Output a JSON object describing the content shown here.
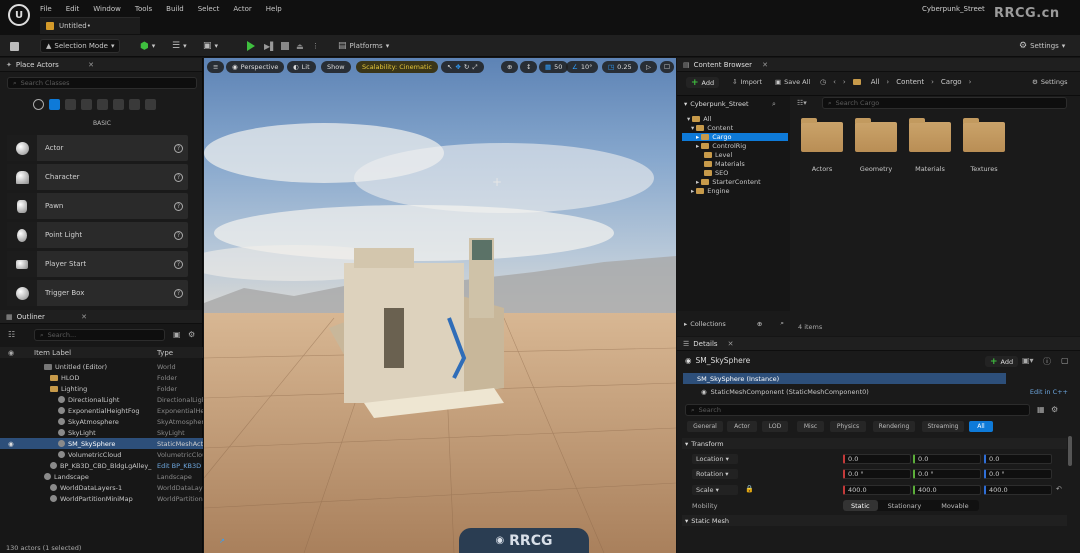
{
  "menu": [
    "File",
    "Edit",
    "Window",
    "Tools",
    "Build",
    "Select",
    "Actor",
    "Help"
  ],
  "tab_title": "Untitled•",
  "project_name": "Cyberpunk_Street",
  "watermark": "RRCG.cn",
  "toolbar": {
    "selection_mode": "Selection Mode",
    "platforms": "Platforms",
    "settings": "Settings"
  },
  "place_actors": {
    "title": "Place Actors",
    "search_placeholder": "Search Classes",
    "category": "BASIC",
    "items": [
      "Actor",
      "Character",
      "Pawn",
      "Point Light",
      "Player Start",
      "Trigger Box"
    ]
  },
  "outliner": {
    "title": "Outliner",
    "search_placeholder": "Search...",
    "col_label": "Item Label",
    "col_type": "Type",
    "rows": [
      {
        "label": "Untitled (Editor)",
        "type": "World"
      },
      {
        "label": "HLOD",
        "type": "Folder"
      },
      {
        "label": "Lighting",
        "type": "Folder"
      },
      {
        "label": "DirectionalLight",
        "type": "DirectionalLight"
      },
      {
        "label": "ExponentialHeightFog",
        "type": "ExponentialHeightFog"
      },
      {
        "label": "SkyAtmosphere",
        "type": "SkyAtmosphere"
      },
      {
        "label": "SkyLight",
        "type": "SkyLight"
      },
      {
        "label": "SM_SkySphere",
        "type": "StaticMeshActor"
      },
      {
        "label": "VolumetricCloud",
        "type": "VolumetricCloud"
      },
      {
        "label": "BP_KB3D_CBD_BldgLgAlley_",
        "type": "Edit BP_KB3D"
      },
      {
        "label": "Landscape",
        "type": "Landscape"
      },
      {
        "label": "WorldDataLayers-1",
        "type": "WorldDataLayers"
      },
      {
        "label": "WorldPartitionMiniMap",
        "type": "WorldPartitionMiniMap"
      }
    ],
    "status": "130 actors (1 selected)"
  },
  "viewport": {
    "perspective": "Perspective",
    "lit": "Lit",
    "show": "Show",
    "scalability": "Scalability: Cinematic",
    "grid": "50",
    "angle": "10°",
    "scale": "0.25",
    "camera_speed": "4"
  },
  "content_browser": {
    "title": "Content Browser",
    "add": "Add",
    "import": "Import",
    "save_all": "Save All",
    "path": [
      "All",
      "Content",
      "Cargo"
    ],
    "settings": "Settings",
    "root": "Cyberpunk_Street",
    "search_placeholder": "Search Cargo",
    "tree": [
      "All",
      "Content",
      "Cargo",
      "ControlRig",
      "Level",
      "Materials",
      "SEO",
      "StarterContent",
      "Engine"
    ],
    "folders": [
      "Actors",
      "Geometry",
      "Materials",
      "Textures"
    ],
    "collections": "Collections",
    "item_count": "4 items"
  },
  "details": {
    "title": "Details",
    "object": "SM_SkySphere",
    "add": "Add",
    "instance": "SM_SkySphere (Instance)",
    "component": "StaticMeshComponent (StaticMeshComponent0)",
    "edit_cpp": "Edit in C++",
    "search_placeholder": "Search",
    "tabs": [
      "General",
      "Actor",
      "LOD",
      "Misc",
      "Physics",
      "Rendering",
      "Streaming",
      "All"
    ],
    "transform_header": "Transform",
    "location_label": "Location",
    "rotation_label": "Rotation",
    "scale_label": "Scale",
    "location": [
      "0.0",
      "0.0",
      "0.0"
    ],
    "rotation": [
      "0.0 °",
      "0.0 °",
      "0.0 °"
    ],
    "scale": [
      "400.0",
      "400.0",
      "400.0"
    ],
    "mobility_label": "Mobility",
    "mobility": [
      "Static",
      "Stationary",
      "Movable"
    ],
    "static_mesh_header": "Static Mesh"
  },
  "colors": {
    "accent_blue": "#0e7ad8",
    "selection": "#2d4f7a",
    "green": "#3fbf3f",
    "folder": "#c79a4a"
  }
}
